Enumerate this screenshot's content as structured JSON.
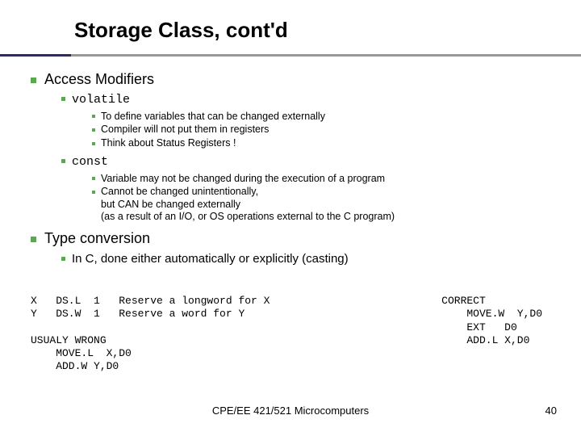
{
  "title": "Storage Class, cont'd",
  "sections": {
    "access_modifiers": {
      "heading": "Access Modifiers",
      "volatile": {
        "label": "volatile",
        "points": [
          "To define variables that can be changed externally",
          "Compiler will not put them in registers",
          "Think about Status Registers !"
        ]
      },
      "const": {
        "label": "const",
        "points": [
          "Variable may not be changed during the execution of a program",
          "Cannot be changed unintentionally,\nbut CAN be changed externally\n(as a result of an I/O, or OS operations external to the C program)"
        ]
      }
    },
    "type_conversion": {
      "heading": "Type conversion",
      "point": "In C, done either automatically or explicitly (casting)"
    }
  },
  "code_left": "X   DS.L  1   Reserve a longword for X\nY   DS.W  1   Reserve a word for Y\n\nUSUALY WRONG\n    MOVE.L  X,D0\n    ADD.W Y,D0",
  "code_right": "CORRECT\n    MOVE.W  Y,D0\n    EXT   D0\n    ADD.L X,D0",
  "footer_center": "CPE/EE 421/521 Microcomputers",
  "footer_page": "40"
}
